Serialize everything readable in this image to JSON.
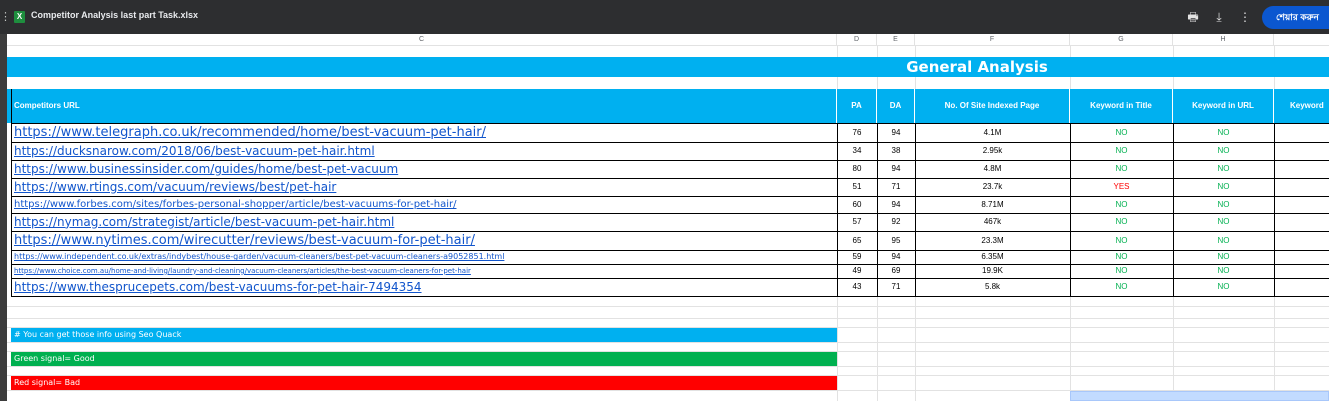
{
  "titlebar": {
    "lead_glyph": "⋮",
    "app_icon": "X",
    "file_name": "Competitor Analysis last part Task.xlsx",
    "print_icon": "🖶",
    "download_icon": "⤓",
    "more_icon": "⋮",
    "share_label": "শেয়ার করুন"
  },
  "columns": [
    "C",
    "D",
    "E",
    "F",
    "G",
    "H"
  ],
  "sheet": {
    "banner_title": "General Analysis",
    "headers": {
      "url": "Competitors URL",
      "pa": "PA",
      "da": "DA",
      "indexed": "No. Of Site Indexed Page",
      "kw_title": "Keyword in Title",
      "kw_url": "Keyword in URL",
      "kw_next": "Keyword"
    },
    "rows": [
      {
        "url": "https://www.telegraph.co.uk/recommended/home/best-vacuum-pet-hair/",
        "pa": "76",
        "da": "94",
        "indexed": "4.1M",
        "kw_title": "NO",
        "kw_url": "NO"
      },
      {
        "url": "https://ducksnarow.com/2018/06/best-vacuum-pet-hair.html",
        "pa": "34",
        "da": "38",
        "indexed": "2.95k",
        "kw_title": "NO",
        "kw_url": "NO"
      },
      {
        "url": "https://www.businessinsider.com/guides/home/best-pet-vacuum",
        "pa": "80",
        "da": "94",
        "indexed": "4.8M",
        "kw_title": "NO",
        "kw_url": "NO"
      },
      {
        "url": "https://www.rtings.com/vacuum/reviews/best/pet-hair",
        "pa": "51",
        "da": "71",
        "indexed": "23.7k",
        "kw_title": "YES",
        "kw_url": "NO"
      },
      {
        "url": "https://www.forbes.com/sites/forbes-personal-shopper/article/best-vacuums-for-pet-hair/",
        "pa": "60",
        "da": "94",
        "indexed": "8.71M",
        "kw_title": "NO",
        "kw_url": "NO"
      },
      {
        "url": "https://nymag.com/strategist/article/best-vacuum-pet-hair.html",
        "pa": "57",
        "da": "92",
        "indexed": "467k",
        "kw_title": "NO",
        "kw_url": "NO"
      },
      {
        "url": "https://www.nytimes.com/wirecutter/reviews/best-vacuum-for-pet-hair/",
        "pa": "65",
        "da": "95",
        "indexed": "23.3M",
        "kw_title": "NO",
        "kw_url": "NO"
      },
      {
        "url": "https://www.independent.co.uk/extras/indybest/house-garden/vacuum-cleaners/best-pet-vacuum-cleaners-a9052851.html",
        "pa": "59",
        "da": "94",
        "indexed": "6.35M",
        "kw_title": "NO",
        "kw_url": "NO"
      },
      {
        "url": "https://www.choice.com.au/home-and-living/laundry-and-cleaning/vacuum-cleaners/articles/the-best-vacuum-cleaners-for-pet-hair",
        "pa": "49",
        "da": "69",
        "indexed": "19.9K",
        "kw_title": "NO",
        "kw_url": "NO"
      },
      {
        "url": "https://www.thesprucepets.com/best-vacuums-for-pet-hair-7494354",
        "pa": "43",
        "da": "71",
        "indexed": "5.8k",
        "kw_title": "NO",
        "kw_url": "NO"
      }
    ],
    "notes": [
      {
        "text": "# You can get those info using Seo Quack",
        "color": "#00b0f0"
      },
      {
        "text": "Green signal= Good",
        "color": "#00b050"
      },
      {
        "text": "Red signal= Bad",
        "color": "#ff0000"
      }
    ]
  },
  "colors": {
    "header_blue": "#00b0f0",
    "good_green": "#00b050",
    "bad_red": "#ff0000",
    "link_blue": "#1155cc",
    "topbar": "#2d2e30",
    "share_button": "#0b57d0"
  }
}
